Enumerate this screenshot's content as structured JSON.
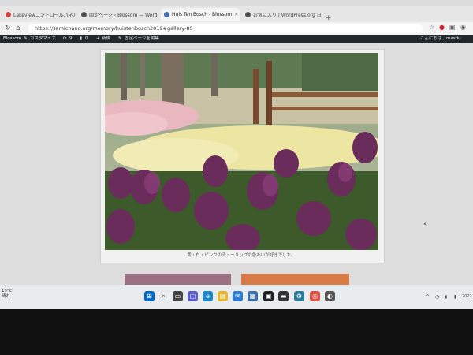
{
  "tabs": [
    {
      "label": "Lakeviewコントロールパネル",
      "color": "#d7443a"
    },
    {
      "label": "固定ページ ‹ Blossom — WordPress",
      "color": "#555555"
    },
    {
      "label": "Huis Ten Bosch - Blossom",
      "color": "#3a6fb0"
    },
    {
      "label": "お気に入り | WordPress.org 日本",
      "color": "#555555"
    }
  ],
  "active_tab": 2,
  "new_tab_symbol": "+",
  "address": {
    "url": "https://samichano.org/memory/huistenbosch2019#gallery-85"
  },
  "admin_bar": {
    "site": "Blossom",
    "customize": "カスタマイズ",
    "updates": "9",
    "comments": "0",
    "new": "新規",
    "edit": "固定ページを編集",
    "greeting": "こんにちは、masdu"
  },
  "gallery": {
    "caption": "黄・白・ピンクのチューリップの色あいが好きでした。"
  },
  "taskbar": {
    "weather_temp": "19°C",
    "weather_text": "晴れ",
    "date": "2022"
  },
  "colors": {
    "admin_bar": "#23282d",
    "taskbar": "#e9ecef",
    "accent": "#0067c0"
  }
}
